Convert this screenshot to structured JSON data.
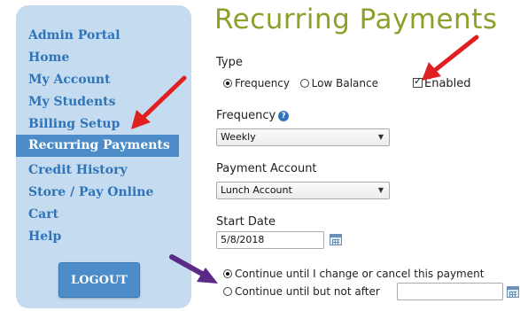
{
  "sidebar": {
    "items": [
      {
        "label": "Admin Portal"
      },
      {
        "label": "Home"
      },
      {
        "label": "My Account"
      },
      {
        "label": "My Students"
      },
      {
        "label": "Billing Setup"
      },
      {
        "label": "Recurring Payments",
        "active": true
      },
      {
        "label": "Credit History"
      },
      {
        "label": "Store / Pay Online"
      },
      {
        "label": "Cart"
      },
      {
        "label": "Help"
      }
    ],
    "logout_label": "LOGOUT"
  },
  "main": {
    "title": "Recurring Payments",
    "type": {
      "label": "Type",
      "option_frequency": "Frequency",
      "option_low_balance": "Low Balance",
      "selected": "Frequency",
      "enabled_label": "Enabled",
      "enabled_checked": true
    },
    "frequency": {
      "label": "Frequency",
      "value": "Weekly",
      "help_icon": "question-circle-icon"
    },
    "payment_account": {
      "label": "Payment Account",
      "value": "Lunch Account"
    },
    "start_date": {
      "label": "Start Date",
      "value": "5/8/2018",
      "icon": "calendar-icon"
    },
    "end_options": {
      "option_until_cancel": "Continue until I change or cancel this payment",
      "option_until_date": "Continue until but not after",
      "selected": "until_cancel",
      "end_date_value": "",
      "icon": "calendar-icon"
    }
  },
  "annotations": {
    "arrow_color_red": "#e02020",
    "arrow_color_purple": "#5b2a86"
  }
}
